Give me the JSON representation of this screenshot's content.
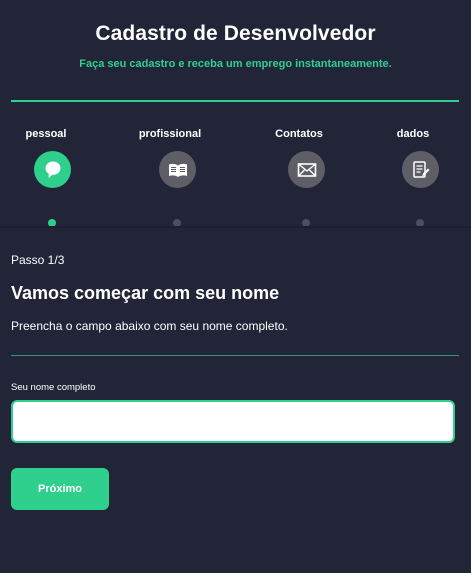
{
  "header": {
    "title": "Cadastro de Desenvolvedor",
    "subtitle": "Faça seu cadastro e receba um emprego instantaneamente."
  },
  "steps": [
    {
      "label": "pessoal",
      "icon": "chat-bubble-icon",
      "active": true
    },
    {
      "label": "profissional",
      "icon": "book-icon",
      "active": false
    },
    {
      "label": "Contatos",
      "icon": "envelope-icon",
      "active": false
    },
    {
      "label": "dados",
      "icon": "document-edit-icon",
      "active": false
    }
  ],
  "form": {
    "step_text": "Passo 1/3",
    "heading": "Vamos começar com seu nome",
    "description": "Preencha o campo abaixo com seu nome completo.",
    "name_label": "Seu nome completo",
    "name_value": "",
    "next_button": "Próximo"
  },
  "colors": {
    "background": "#222538",
    "accent": "#2fcf8e",
    "inactive_step": "#5e5f66"
  }
}
